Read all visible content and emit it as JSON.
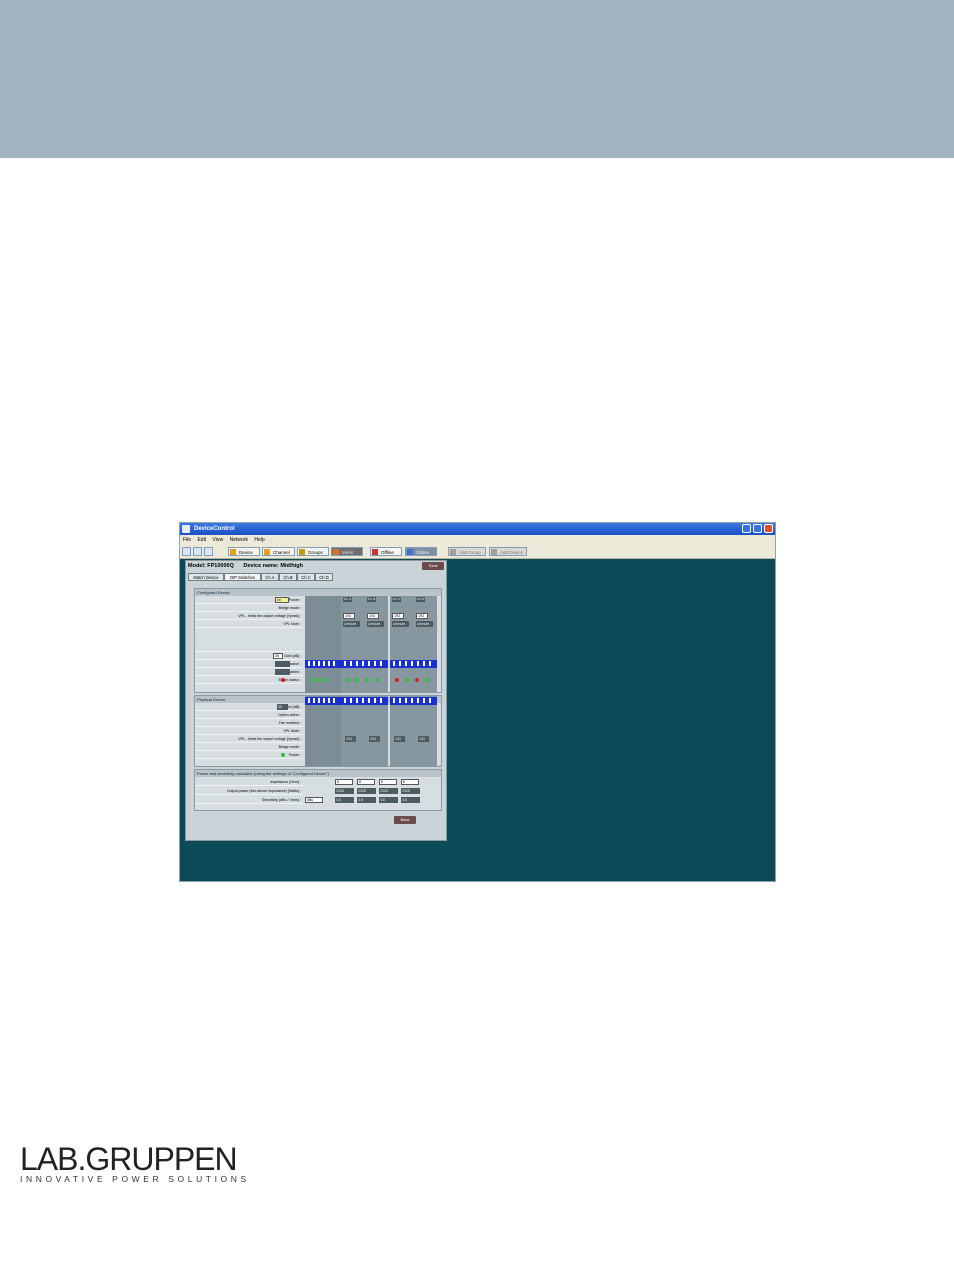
{
  "app": {
    "window_title": "DeviceControl",
    "menu": [
      "File",
      "Edit",
      "View",
      "Network",
      "Help"
    ],
    "toolbar": {
      "device": "Device",
      "channel": "Channel",
      "groups": "Groups",
      "meter": "Meter",
      "offline": "Offline",
      "online": "Online",
      "add_group": "Add Group",
      "add_device": "Add Device"
    }
  },
  "panel": {
    "model": "Model: FP10000Q",
    "device_name": "Device name: Mid/high",
    "tool_button": "Tools",
    "tabs": [
      "Match Device",
      "DIP Switches",
      "Ch.A",
      "Ch.B",
      "Ch.C",
      "Ch.D"
    ],
    "configured_device": {
      "title": "Configured Device",
      "rows": [
        "Power :",
        "Bridge mode :",
        "VPL - limits the output voltage [Vpeak] :",
        "VPL Mute :",
        "",
        "Gain [dB] :",
        "Option active :",
        "Fan enabled :",
        "Match status :"
      ],
      "power_value": "on",
      "gain_value": "35",
      "vpl_values": [
        "193",
        "193",
        "193",
        "193"
      ],
      "vpl_mute": [
        "Unmute",
        "Unmute",
        "Unmute",
        "Unmute"
      ]
    },
    "physical_device": {
      "title": "Physical Device",
      "rows": [
        "Gain [dB] :",
        "Option active :",
        "Fan enabled :",
        "VPL Mute :",
        "VPL - limits the output voltage [Vpeak] :",
        "Bridge mode :",
        "Power :"
      ],
      "gain_value": "35",
      "vpl_values": [
        "193",
        "193",
        "193",
        "193"
      ]
    },
    "power_section": {
      "title": "Power and sensitivity calculator (using the settings of \"Configured Device\")",
      "rows": [
        "Impedance [Ohm] :",
        "Output power (into above impedance) [Watts] :",
        "Sensitivity (dBu / Vrms) :"
      ],
      "impedance": [
        "8",
        "8",
        "8",
        "8"
      ],
      "output_power": [
        "2328",
        "2328",
        "2328",
        "2328"
      ],
      "sensitivity": [
        "4.8",
        "4.8",
        "4.8",
        "4.8"
      ],
      "sensitivity_unit": "dBu"
    },
    "channels": [
      "Ch. A",
      "Ch. B",
      "Ch. C",
      "Ch. D"
    ],
    "footer_button": "Back"
  },
  "logo": {
    "brand": "LAB.GRUPPEN",
    "tagline": "INNOVATIVE POWER SOLUTIONS"
  },
  "colors": {
    "header_band": "#a0b4bf",
    "desktop_bg": "#0c4a58",
    "led_red": "#d02020",
    "led_green": "#30c040"
  }
}
